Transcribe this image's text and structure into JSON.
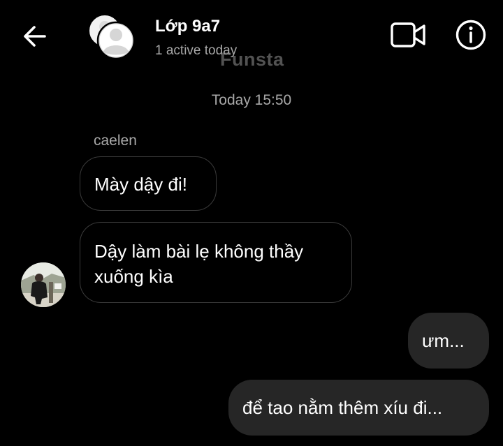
{
  "header": {
    "title": "Lớp 9a7",
    "subtitle": "1 active today",
    "back_icon": "arrow-left-icon",
    "video_icon": "video-camera-icon",
    "info_icon": "info-icon"
  },
  "watermark": "Funsta",
  "conversation": {
    "timestamp": "Today 15:50",
    "sender_name": "caelen",
    "messages": [
      {
        "direction": "incoming",
        "text": "Mày dậy đi!"
      },
      {
        "direction": "incoming",
        "lines": [
          "Dậy làm bài lẹ không thầy",
          "xuống kìa"
        ]
      },
      {
        "direction": "outgoing",
        "text": "ưm..."
      },
      {
        "direction": "outgoing",
        "text": "để tao nằm thêm xíu đi..."
      }
    ]
  },
  "colors": {
    "background": "#000000",
    "outgoing_bubble": "#262626",
    "incoming_border": "#3a3a3a",
    "secondary_text": "#a8a8a8"
  }
}
